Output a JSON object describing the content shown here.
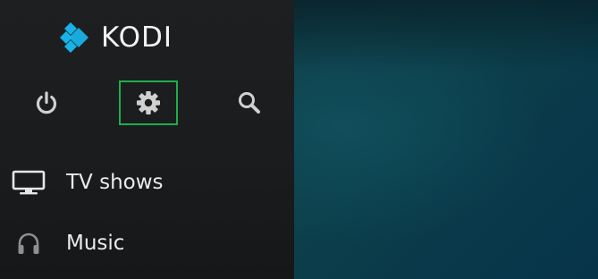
{
  "app": {
    "logo_text": "KODI",
    "accent_color": "#1fae4b",
    "logo_color": "#17b2e7"
  },
  "toolbar": {
    "buttons": [
      {
        "name": "power",
        "icon": "power-icon"
      },
      {
        "name": "settings",
        "icon": "gear-icon",
        "focused": true
      },
      {
        "name": "search",
        "icon": "search-icon"
      }
    ]
  },
  "menu": {
    "items": [
      {
        "label": "TV shows",
        "icon": "tv-icon"
      },
      {
        "label": "Music",
        "icon": "headphones-icon"
      }
    ]
  }
}
